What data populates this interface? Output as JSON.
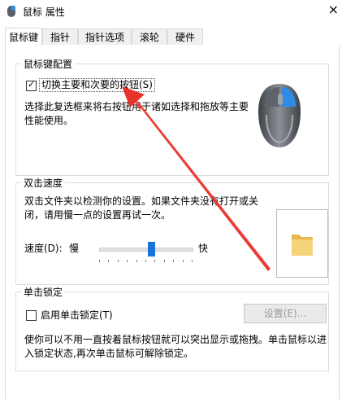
{
  "window": {
    "title": "鼠标 属性",
    "close_glyph": "×"
  },
  "tabs": [
    {
      "label": "鼠标键",
      "active": true
    },
    {
      "label": "指针",
      "active": false
    },
    {
      "label": "指针选项",
      "active": false
    },
    {
      "label": "滚轮",
      "active": false
    },
    {
      "label": "硬件",
      "active": false
    }
  ],
  "button_config": {
    "title": "鼠标键配置",
    "switch_checkbox": {
      "label": "切换主要和次要的按钮(S)",
      "checked": true
    },
    "description_line1": "选择此复选框来将右按钮用于诸如选择和拖放等主要",
    "description_line2": "性能使用。"
  },
  "double_click": {
    "title": "双击速度",
    "description_line1": "双击文件夹以检测你的设置。如果文件夹没有打开或关",
    "description_line2": "闭，请用慢一点的设置再试一次。",
    "speed_label": "速度(D):",
    "slow_label": "慢",
    "fast_label": "快",
    "speed_level_fraction": 0.56
  },
  "click_lock": {
    "title": "单击锁定",
    "checkbox": {
      "label": "启用单击锁定(T)",
      "checked": false
    },
    "settings_button": "设置(E)...",
    "description_line1": "使你可以不用一直按着鼠标按钮就可以突出显示或拖拽。单击鼠标以进",
    "description_line2": "入锁定状态,再次单击鼠标可解除锁定。"
  },
  "colors": {
    "accent": "#1a73d9",
    "annotation_arrow": "#e8332a",
    "folder": "#f1c761"
  }
}
